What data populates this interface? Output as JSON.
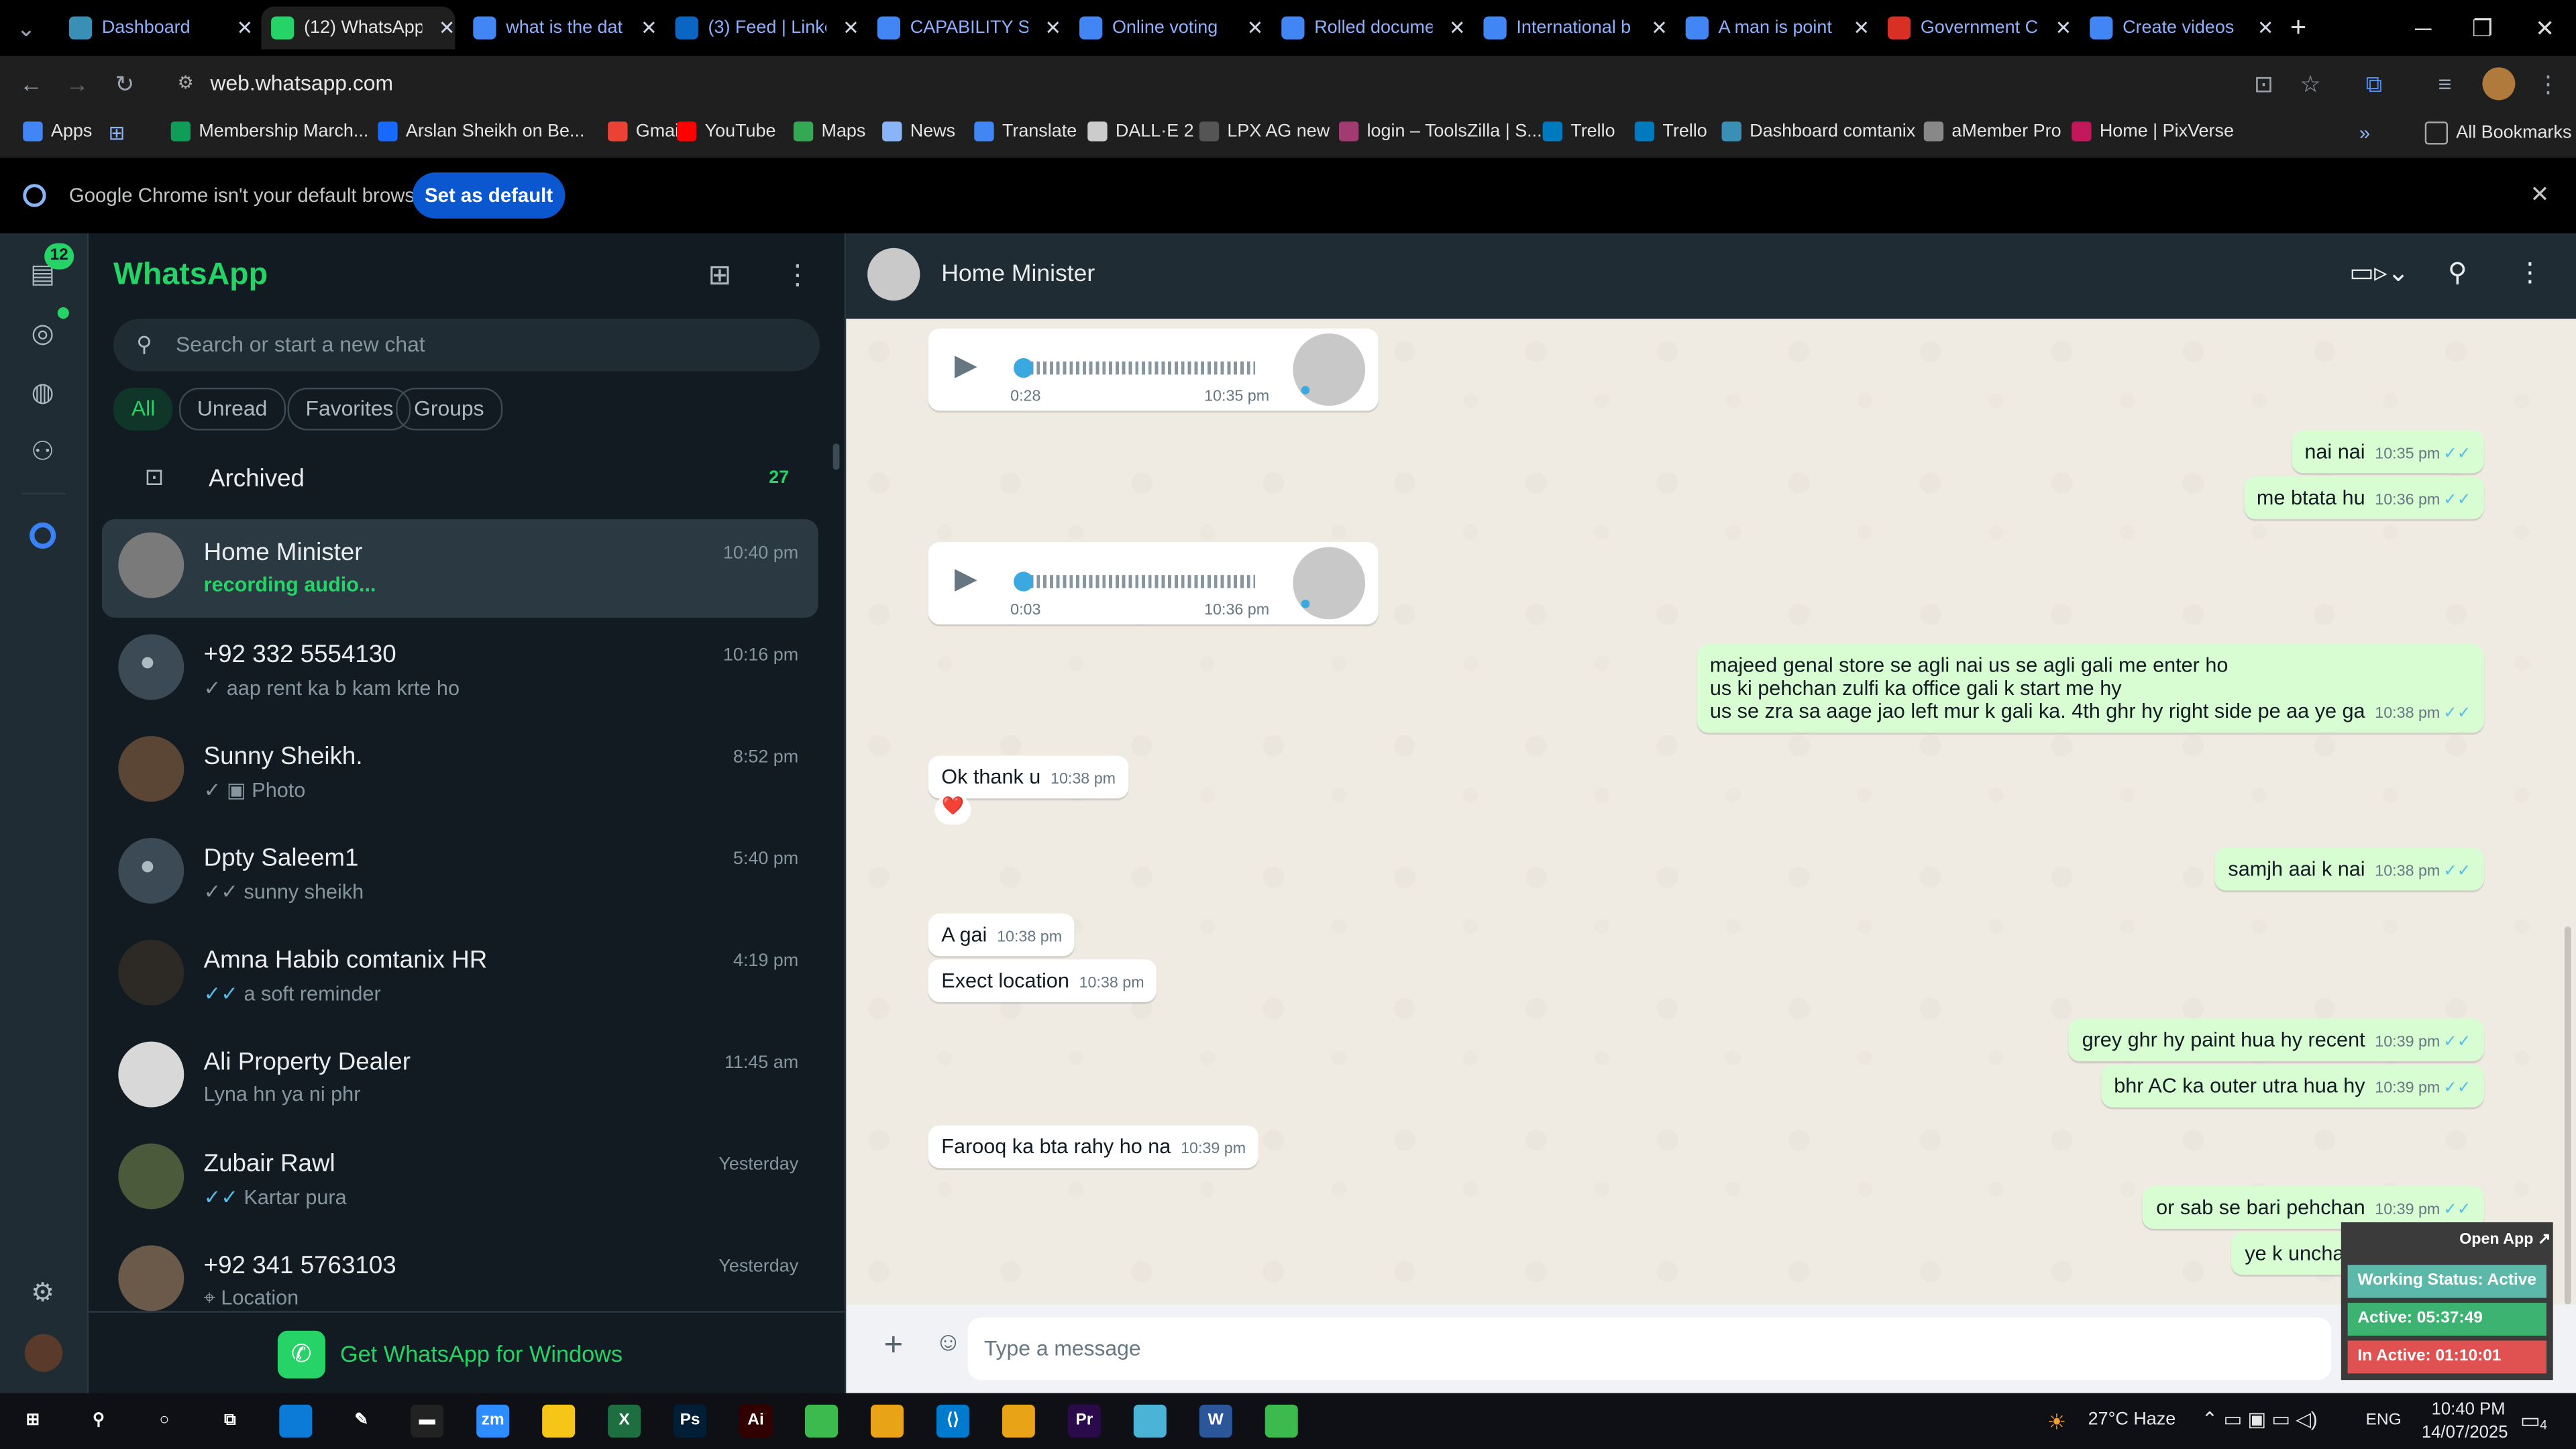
{
  "browser": {
    "tabs": [
      {
        "label": "Dashboard",
        "icon": "dashboard-tab-icon",
        "color": "#3a8fb7"
      },
      {
        "label": "(12) WhatsApp",
        "icon": "whatsapp-tab-icon",
        "color": "#25d366"
      },
      {
        "label": "what is the dat",
        "icon": "google-tab-icon",
        "color": "#4285f4"
      },
      {
        "label": "(3) Feed | Linke",
        "icon": "linkedin-tab-icon",
        "color": "#0a66c2"
      },
      {
        "label": "CAPABILITY ST",
        "icon": "docs-tab-icon",
        "color": "#4285f4"
      },
      {
        "label": "Online voting",
        "icon": "docs-tab-icon",
        "color": "#4285f4"
      },
      {
        "label": "Rolled docume",
        "icon": "docs-tab-icon",
        "color": "#4285f4"
      },
      {
        "label": "International b",
        "icon": "docs-tab-icon",
        "color": "#4285f4"
      },
      {
        "label": "A man is point",
        "icon": "docs-tab-icon",
        "color": "#4285f4"
      },
      {
        "label": "Government C",
        "icon": "red-tab-icon",
        "color": "#d93025"
      },
      {
        "label": "Create videos",
        "icon": "docs-tab-icon",
        "color": "#4285f4"
      }
    ],
    "url": "web.whatsapp.com",
    "bookmarks": [
      {
        "label": "Apps",
        "color": "#4285f4"
      },
      {
        "label": "Membership March...",
        "color": "#0f9d58"
      },
      {
        "label": "Arslan Sheikh on Be...",
        "color": "#1769ff"
      },
      {
        "label": "Gmail",
        "color": "#ea4335"
      },
      {
        "label": "YouTube",
        "color": "#ff0000"
      },
      {
        "label": "Maps",
        "color": "#34a853"
      },
      {
        "label": "News",
        "color": "#8ab4f8"
      },
      {
        "label": "Translate",
        "color": "#4285f4"
      },
      {
        "label": "DALL·E 2",
        "color": "#cccccc"
      },
      {
        "label": "LPX AG new",
        "color": "#555555"
      },
      {
        "label": "login – ToolsZilla | S...",
        "color": "#a23b72"
      },
      {
        "label": "Trello",
        "color": "#0079bf"
      },
      {
        "label": "Trello",
        "color": "#0079bf"
      },
      {
        "label": "Dashboard comtanix",
        "color": "#3a8fb7"
      },
      {
        "label": "aMember Pro",
        "color": "#888888"
      },
      {
        "label": "Home | PixVerse",
        "color": "#c2185b"
      }
    ],
    "all_bookmarks": "All Bookmarks",
    "infobar_text": "Google Chrome isn't your default browser",
    "set_default": "Set as default"
  },
  "sidebar": {
    "unread_badge": "12",
    "title": "WhatsApp",
    "search_placeholder": "Search or start a new chat",
    "filters": [
      "All",
      "Unread",
      "Favorites",
      "Groups"
    ],
    "archived_label": "Archived",
    "archived_count": "27",
    "chats": [
      {
        "name": "Home Minister",
        "preview": "recording audio...",
        "time": "10:40 pm",
        "status": "recording",
        "avatar": "photo"
      },
      {
        "name": "+92 332 5554130",
        "preview": "aap rent ka b kam krte ho",
        "time": "10:16 pm",
        "status": "sent",
        "avatar": "default"
      },
      {
        "name": "Sunny Sheikh.",
        "preview": "Photo",
        "time": "8:52 pm",
        "status": "sent-photo",
        "avatar": "photo"
      },
      {
        "name": "Dpty Saleem1",
        "preview": "sunny sheikh",
        "time": "5:40 pm",
        "status": "delivered",
        "avatar": "default"
      },
      {
        "name": "Amna Habib comtanix HR",
        "preview": "a soft reminder",
        "time": "4:19 pm",
        "status": "read",
        "avatar": "photo"
      },
      {
        "name": "Ali Property Dealer",
        "preview": "Lyna hn ya ni phr",
        "time": "11:45 am",
        "status": "none",
        "avatar": "photo"
      },
      {
        "name": "Zubair Rawl",
        "preview": "Kartar pura",
        "time": "Yesterday",
        "status": "read",
        "avatar": "photo"
      },
      {
        "name": "+92 341 5763103",
        "preview": "Location",
        "time": "Yesterday",
        "status": "location",
        "avatar": "photo"
      }
    ],
    "get_app": "Get WhatsApp for Windows"
  },
  "conversation": {
    "contact": "Home Minister",
    "composer_placeholder": "Type a message",
    "messages": [
      {
        "dir": "in",
        "kind": "voice",
        "duration": "0:28",
        "time": "10:35 pm"
      },
      {
        "dir": "out",
        "text": "nai nai",
        "time": "10:35 pm"
      },
      {
        "dir": "out",
        "text": "me btata hu",
        "time": "10:36 pm"
      },
      {
        "dir": "in",
        "kind": "voice",
        "duration": "0:03",
        "time": "10:36 pm"
      },
      {
        "dir": "out",
        "lines": [
          "majeed  genal store se agli nai us se agli gali me enter ho",
          "us ki pehchan zulfi ka office gali k start me hy",
          "us se zra sa aage jao left mur k gali ka. 4th ghr hy right side pe aa ye ga"
        ],
        "time": "10:38 pm"
      },
      {
        "dir": "in",
        "text": "Ok thank u",
        "time": "10:38 pm",
        "reaction": "❤️"
      },
      {
        "dir": "out",
        "text": "samjh aai k nai",
        "time": "10:38 pm"
      },
      {
        "dir": "in",
        "text": "A gai",
        "time": "10:38 pm"
      },
      {
        "dir": "in",
        "text": "Exect location",
        "time": "10:38 pm"
      },
      {
        "dir": "out",
        "text": "grey ghr hy paint hua hy recent",
        "time": "10:39 pm"
      },
      {
        "dir": "out",
        "text": "bhr AC ka outer utra hua hy",
        "time": "10:39 pm"
      },
      {
        "dir": "in",
        "text": "Farooq ka bta rahy ho na",
        "time": "10:39 pm"
      },
      {
        "dir": "out",
        "text": "or sab se bari pehchan",
        "time": "10:39 pm"
      },
      {
        "dir": "out",
        "text": "ye k uncha sa thra hy",
        "time": ""
      }
    ]
  },
  "widget": {
    "open_app": "Open App ↗",
    "working_status": "Working Status: Active",
    "active": "Active: 05:37:49",
    "inactive": "In Active: 01:10:01",
    "colors": {
      "status": "#5cb8a8",
      "active": "#3cb371",
      "inactive": "#e05252"
    }
  },
  "taskbar": {
    "weather": "27°C  Haze",
    "lang": "ENG",
    "time": "10:40 PM",
    "date": "14/07/2025",
    "notif_count": "4",
    "apps": [
      "start",
      "search",
      "cortana",
      "taskview",
      "edge",
      "pen",
      "terminal",
      "zoom",
      "explorer",
      "excel",
      "photoshop",
      "illustrator",
      "green-app",
      "chrome",
      "vscode",
      "chrome-2",
      "premiere",
      "app",
      "word",
      "green-app-2"
    ]
  },
  "colors": {
    "accent": "#25d366",
    "bubble_out": "#d9fdd3",
    "chat_bg": "#efeae2",
    "panel": "#111b21",
    "header": "#202c33"
  }
}
